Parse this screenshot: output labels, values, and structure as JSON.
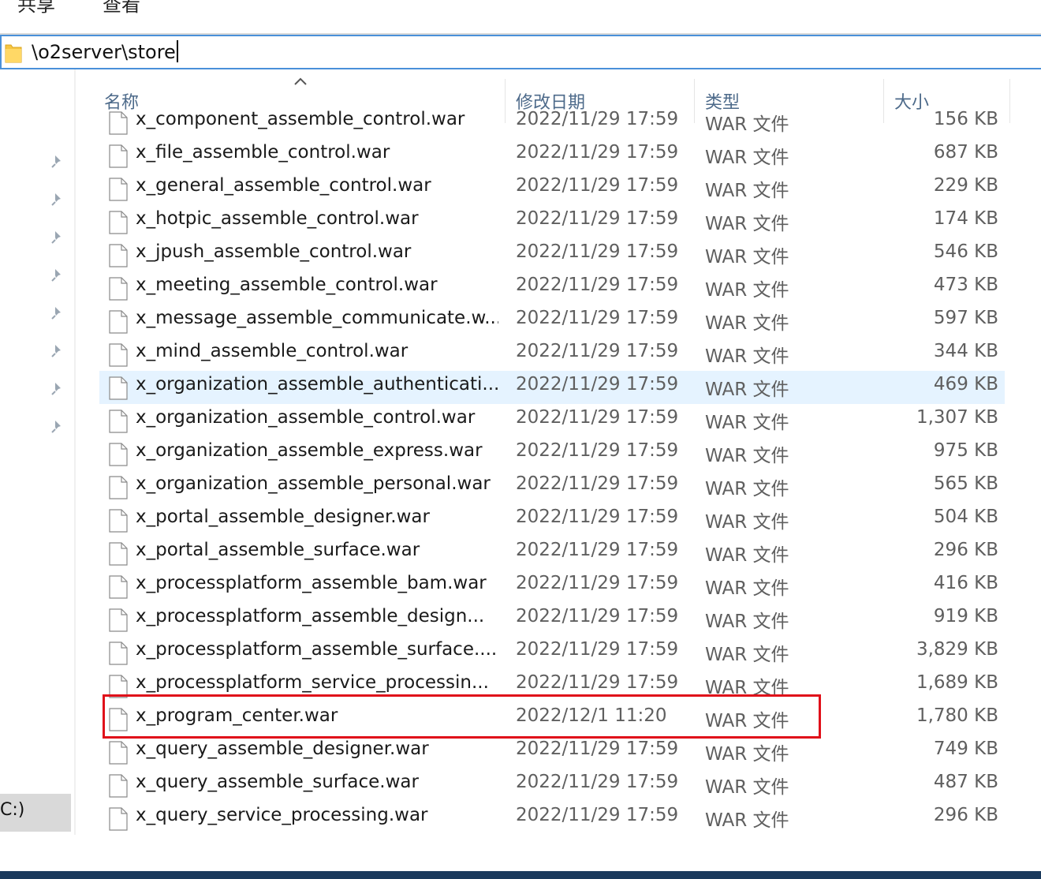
{
  "ribbon": {
    "tabs": [
      "共享",
      "查看"
    ]
  },
  "address": {
    "path": "\\o2server\\store"
  },
  "nav": {
    "pins": 8,
    "drive_label": "C:)"
  },
  "columns": {
    "name": "名称",
    "date": "修改日期",
    "type": "类型",
    "size": "大小"
  },
  "files": [
    {
      "name": "x_component_assemble_control.war",
      "date": "2022/11/29 17:59",
      "type": "WAR 文件",
      "size": "156 KB"
    },
    {
      "name": "x_file_assemble_control.war",
      "date": "2022/11/29 17:59",
      "type": "WAR 文件",
      "size": "687 KB"
    },
    {
      "name": "x_general_assemble_control.war",
      "date": "2022/11/29 17:59",
      "type": "WAR 文件",
      "size": "229 KB"
    },
    {
      "name": "x_hotpic_assemble_control.war",
      "date": "2022/11/29 17:59",
      "type": "WAR 文件",
      "size": "174 KB"
    },
    {
      "name": "x_jpush_assemble_control.war",
      "date": "2022/11/29 17:59",
      "type": "WAR 文件",
      "size": "546 KB"
    },
    {
      "name": "x_meeting_assemble_control.war",
      "date": "2022/11/29 17:59",
      "type": "WAR 文件",
      "size": "473 KB"
    },
    {
      "name": "x_message_assemble_communicate.w...",
      "date": "2022/11/29 17:59",
      "type": "WAR 文件",
      "size": "597 KB"
    },
    {
      "name": "x_mind_assemble_control.war",
      "date": "2022/11/29 17:59",
      "type": "WAR 文件",
      "size": "344 KB"
    },
    {
      "name": "x_organization_assemble_authenticati...",
      "date": "2022/11/29 17:59",
      "type": "WAR 文件",
      "size": "469 KB"
    },
    {
      "name": "x_organization_assemble_control.war",
      "date": "2022/11/29 17:59",
      "type": "WAR 文件",
      "size": "1,307 KB"
    },
    {
      "name": "x_organization_assemble_express.war",
      "date": "2022/11/29 17:59",
      "type": "WAR 文件",
      "size": "975 KB"
    },
    {
      "name": "x_organization_assemble_personal.war",
      "date": "2022/11/29 17:59",
      "type": "WAR 文件",
      "size": "565 KB"
    },
    {
      "name": "x_portal_assemble_designer.war",
      "date": "2022/11/29 17:59",
      "type": "WAR 文件",
      "size": "504 KB"
    },
    {
      "name": "x_portal_assemble_surface.war",
      "date": "2022/11/29 17:59",
      "type": "WAR 文件",
      "size": "296 KB"
    },
    {
      "name": "x_processplatform_assemble_bam.war",
      "date": "2022/11/29 17:59",
      "type": "WAR 文件",
      "size": "416 KB"
    },
    {
      "name": "x_processplatform_assemble_design...",
      "date": "2022/11/29 17:59",
      "type": "WAR 文件",
      "size": "919 KB"
    },
    {
      "name": "x_processplatform_assemble_surface....",
      "date": "2022/11/29 17:59",
      "type": "WAR 文件",
      "size": "3,829 KB"
    },
    {
      "name": "x_processplatform_service_processin...",
      "date": "2022/11/29 17:59",
      "type": "WAR 文件",
      "size": "1,689 KB"
    },
    {
      "name": "x_program_center.war",
      "date": "2022/12/1 11:20",
      "type": "WAR 文件",
      "size": "1,780 KB"
    },
    {
      "name": "x_query_assemble_designer.war",
      "date": "2022/11/29 17:59",
      "type": "WAR 文件",
      "size": "749 KB"
    },
    {
      "name": "x_query_assemble_surface.war",
      "date": "2022/11/29 17:59",
      "type": "WAR 文件",
      "size": "487 KB"
    },
    {
      "name": "x_query_service_processing.war",
      "date": "2022/11/29 17:59",
      "type": "WAR 文件",
      "size": "296 KB"
    }
  ],
  "selected_index": 8,
  "highlighted_index": 18,
  "colors": {
    "selection": "#e5f3ff",
    "highlight_border": "#e0101a",
    "address_border": "#4a90d9"
  },
  "icons": {
    "folder": "folder-icon",
    "file": "file-icon",
    "pin": "pin-icon",
    "sort": "sort-up-icon"
  }
}
